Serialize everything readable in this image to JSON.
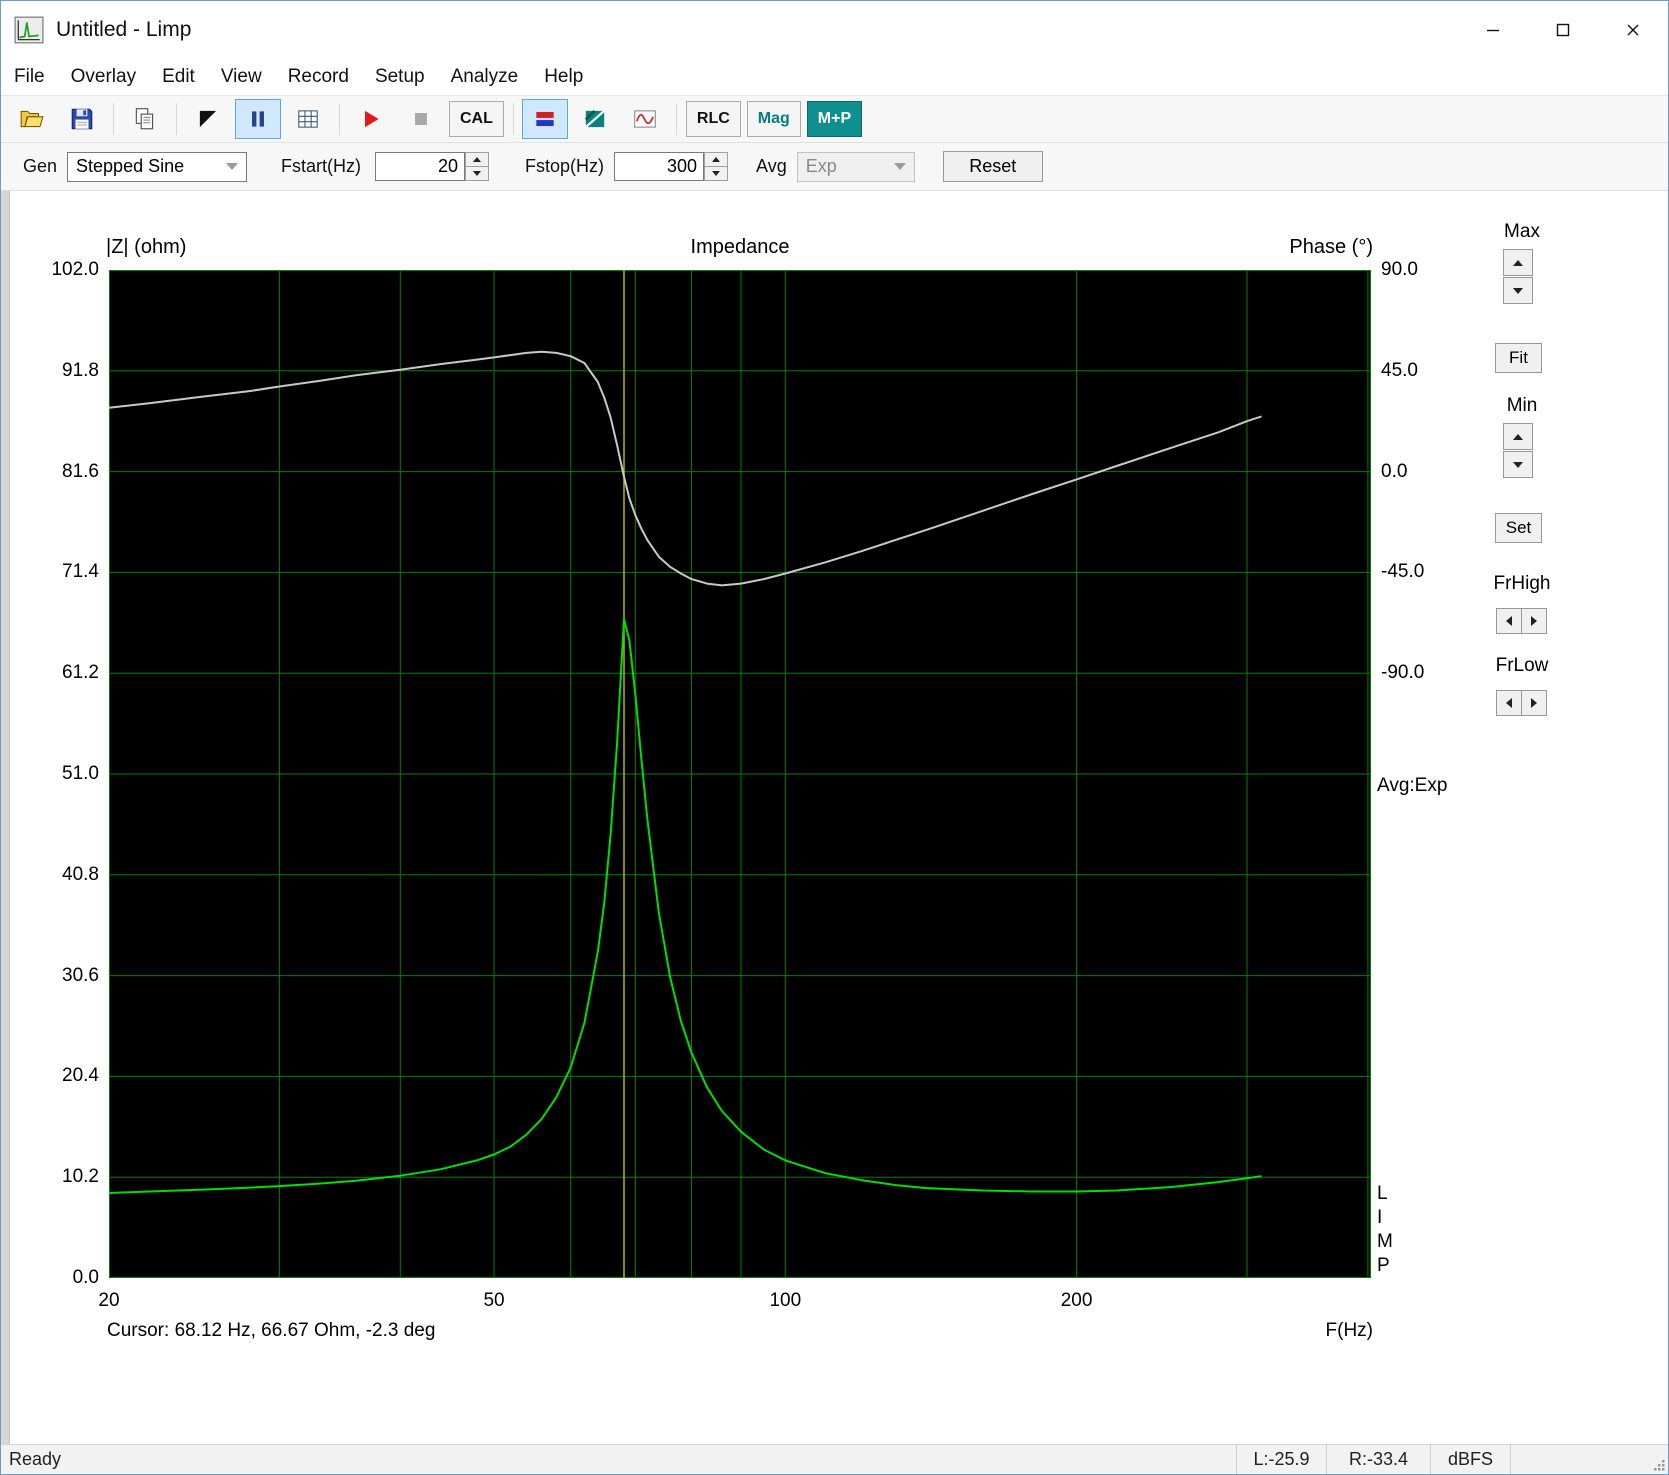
{
  "window": {
    "title": "Untitled - Limp"
  },
  "menu": {
    "items": [
      "File",
      "Overlay",
      "Edit",
      "View",
      "Record",
      "Setup",
      "Analyze",
      "Help"
    ]
  },
  "toolbar": {
    "cal": "CAL",
    "rlc": "RLC",
    "mag": "Mag",
    "mp": "M+P",
    "icon_names": [
      "open-folder-icon",
      "save-icon",
      "copy-icon",
      "flag-icon",
      "pause-icon",
      "table-icon",
      "record-play-icon",
      "stop-icon",
      "signal-bars-icon",
      "spectrum-icon",
      "waveform-icon"
    ],
    "accent_teal": "#008080"
  },
  "controls": {
    "gen_label": "Gen",
    "gen_value": "Stepped Sine",
    "fstart_label": "Fstart(Hz)",
    "fstart_value": "20",
    "fstop_label": "Fstop(Hz)",
    "fstop_value": "300",
    "avg_label": "Avg",
    "avg_value": "Exp",
    "reset_label": "Reset"
  },
  "side_panel": {
    "max": "Max",
    "fit": "Fit",
    "min": "Min",
    "set": "Set",
    "frhigh": "FrHigh",
    "frlow": "FrLow"
  },
  "status_bar": {
    "ready": "Ready",
    "left": "L:-25.9",
    "right": "R:-33.4",
    "unit": "dBFS"
  },
  "chart_data": {
    "type": "line",
    "title": "Impedance",
    "left_axis_label": "|Z| (ohm)",
    "right_axis_label": "Phase (°)",
    "x_axis_label": "F(Hz)",
    "x_scale": "log",
    "x_range_hz": [
      20,
      403
    ],
    "x_tick_labels": [
      20,
      50,
      100,
      200
    ],
    "x_gridlines_hz": [
      30,
      40,
      50,
      60,
      70,
      80,
      90,
      100,
      200,
      300,
      400
    ],
    "left_axis_range": [
      0,
      102
    ],
    "left_tick_labels": [
      "102.0",
      "91.8",
      "81.6",
      "71.4",
      "61.2",
      "51.0",
      "40.8",
      "30.6",
      "20.4",
      "10.2",
      "0.0"
    ],
    "right_tick_labels": [
      "90.0",
      "45.0",
      "0.0",
      "-45.0",
      "-90.0"
    ],
    "right_axis_top_deg": 90,
    "right_axis_deg_per_div": 45,
    "grid": true,
    "cursor": {
      "freq_hz": 68.12,
      "impedance_ohm": 66.67,
      "phase_deg": -2.3,
      "text": "Cursor: 68.12 Hz, 66.67 Ohm, -2.3 deg",
      "color": "#b8b800"
    },
    "annotations": {
      "avg": "Avg:Exp",
      "watermark": "L\nI\nM\nP"
    },
    "colors": {
      "plot_bg": "#000000",
      "grid": "#008000",
      "impedance": "#00e000",
      "phase": "#c9c9c9"
    },
    "series": [
      {
        "name": "Impedance magnitude",
        "axis": "left",
        "unit": "ohm",
        "color": "#00e000",
        "f_hz": [
          20,
          22,
          25,
          28,
          30,
          33,
          36,
          40,
          44,
          48,
          50,
          52,
          54,
          56,
          58,
          60,
          62,
          64,
          65,
          66,
          67,
          68.12,
          69,
          70,
          71,
          72,
          74,
          76,
          78,
          80,
          83,
          86,
          90,
          95,
          100,
          110,
          120,
          130,
          140,
          160,
          180,
          200,
          220,
          250,
          280,
          300,
          310
        ],
        "values": [
          8.6,
          8.75,
          8.95,
          9.15,
          9.3,
          9.55,
          9.85,
          10.35,
          11.0,
          11.9,
          12.5,
          13.3,
          14.5,
          16.1,
          18.3,
          21.3,
          25.8,
          33.0,
          38.0,
          45.0,
          54.0,
          66.67,
          64.5,
          59.0,
          52.5,
          46.5,
          37.0,
          30.5,
          26.0,
          22.8,
          19.3,
          16.9,
          14.8,
          13.0,
          11.9,
          10.6,
          9.9,
          9.4,
          9.1,
          8.85,
          8.75,
          8.75,
          8.85,
          9.2,
          9.7,
          10.1,
          10.3
        ]
      },
      {
        "name": "Phase",
        "axis": "right",
        "unit": "deg",
        "color": "#c9c9c9",
        "f_hz": [
          20,
          22,
          25,
          28,
          30,
          33,
          36,
          40,
          44,
          48,
          50,
          52,
          54,
          56,
          58,
          60,
          62,
          64,
          65,
          66,
          67,
          68.12,
          69,
          70,
          71,
          72,
          74,
          76,
          78,
          80,
          83,
          86,
          90,
          95,
          100,
          110,
          120,
          130,
          140,
          160,
          180,
          200,
          220,
          250,
          280,
          300,
          310
        ],
        "values": [
          28.5,
          30.5,
          33.5,
          36,
          38,
          40.5,
          43,
          45.5,
          48,
          50,
          51,
          52,
          53,
          53.5,
          53,
          51.5,
          48.5,
          40,
          33,
          24,
          12,
          -2.3,
          -12,
          -19.5,
          -25.5,
          -30.5,
          -38,
          -42.5,
          -45.5,
          -48,
          -50,
          -50.8,
          -50,
          -48,
          -45.5,
          -40.5,
          -35.5,
          -30.5,
          -26,
          -17.5,
          -10,
          -3.5,
          2.5,
          10.5,
          17.5,
          22.5,
          24.5
        ]
      }
    ]
  }
}
